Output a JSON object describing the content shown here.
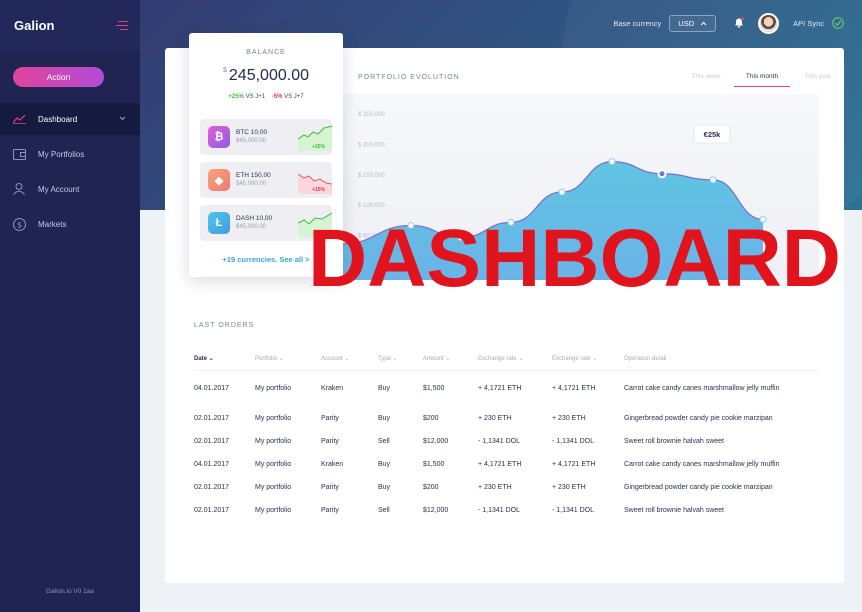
{
  "sidebar": {
    "brand": "Galion",
    "action_label": "Action",
    "items": [
      {
        "label": "Dashboard",
        "icon": "chart-line-icon",
        "active": true
      },
      {
        "label": "My Portfolios",
        "icon": "wallet-icon",
        "active": false
      },
      {
        "label": "My Account",
        "icon": "user-icon",
        "active": false
      },
      {
        "label": "Markets",
        "icon": "dollar-coin-icon",
        "active": false
      }
    ],
    "footer": "Galion.io V0 1aa"
  },
  "topbar": {
    "currency_label": "Base currency",
    "currency_value": "USD",
    "api_sync_label": "API Sync"
  },
  "balance": {
    "label": "BALANCE",
    "currency_symbol": "$",
    "amount": "245,000.00",
    "delta_pos": "+25%",
    "delta_pos_suffix": "VS J+1",
    "delta_neg": "-5%",
    "delta_neg_suffix": "VS J+7",
    "coins": [
      {
        "name": "BTC 10,00",
        "value": "$45,000.00",
        "pct": "+25%",
        "trend": "up",
        "color": "#c05ee8"
      },
      {
        "name": "ETH 150,00",
        "value": "$45,000.00",
        "pct": "+15%",
        "trend": "down",
        "color": "#f18e6d"
      },
      {
        "name": "DASH 10,00",
        "value": "$45,000.00",
        "pct": "+11%",
        "trend": "up",
        "color": "#4fb9e6"
      }
    ],
    "see_all": "+19 currencies. See all >"
  },
  "portfolio": {
    "title": "PORTFOLIO EVOLUTION",
    "tabs": [
      "This week",
      "This month",
      "This year"
    ],
    "active_tab": "This month",
    "tooltip": "€25k"
  },
  "chart_data": {
    "type": "area",
    "title": "PORTFOLIO EVOLUTION",
    "y_ticks": [
      "$ 250.000",
      "$ 200.000",
      "$ 150.000",
      "$ 100.000",
      "$ 50.000"
    ],
    "ylim": [
      0,
      250000
    ],
    "x": [
      1,
      2,
      3,
      4,
      5,
      6,
      7,
      8
    ],
    "values": [
      40000,
      70000,
      50000,
      75000,
      125000,
      175000,
      155000,
      145000,
      80000
    ],
    "grid": false
  },
  "orders": {
    "title": "LAST ORDERS",
    "columns": [
      "Date",
      "Portfolio",
      "Account",
      "Type",
      "Amount",
      "Exchange rate",
      "Exchange rate",
      "Operation detail"
    ],
    "rows": [
      [
        "04.01.2017",
        "My portfolio",
        "Kraken",
        "Buy",
        "$1,500",
        "+ 4,1721 ETH",
        "+ 4,1721 ETH",
        "Carrot cake candy canes marshmallow jelly muffin"
      ],
      [
        "02.01.2017",
        "My portfolio",
        "Parity",
        "Buy",
        "$200",
        "+ 230 ETH",
        "+ 230 ETH",
        "Gingerbread powder candy pie cookie marzipan"
      ],
      [
        "02.01.2017",
        "My portfolio",
        "Parity",
        "Sell",
        "$12,000",
        "- 1,1341 DOL",
        "- 1,1341 DOL",
        "Sweet roll brownie halvah sweet"
      ],
      [
        "04.01.2017",
        "My portfolio",
        "Kraken",
        "Buy",
        "$1,500",
        "+ 4,1721 ETH",
        "+ 4,1721 ETH",
        "Carrot cake candy canes marshmallow jelly muffin"
      ],
      [
        "02.01.2017",
        "My portfolio",
        "Parity",
        "Buy",
        "$200",
        "+ 230 ETH",
        "+ 230 ETH",
        "Gingerbread powder candy pie cookie marzipan"
      ],
      [
        "02.01.2017",
        "My portfolio",
        "Parity",
        "Sell",
        "$12,000",
        "- 1,1341 DOL",
        "- 1,1341 DOL",
        "Sweet roll brownie halvah sweet"
      ]
    ]
  },
  "overlay_text": "DASHBOARD"
}
